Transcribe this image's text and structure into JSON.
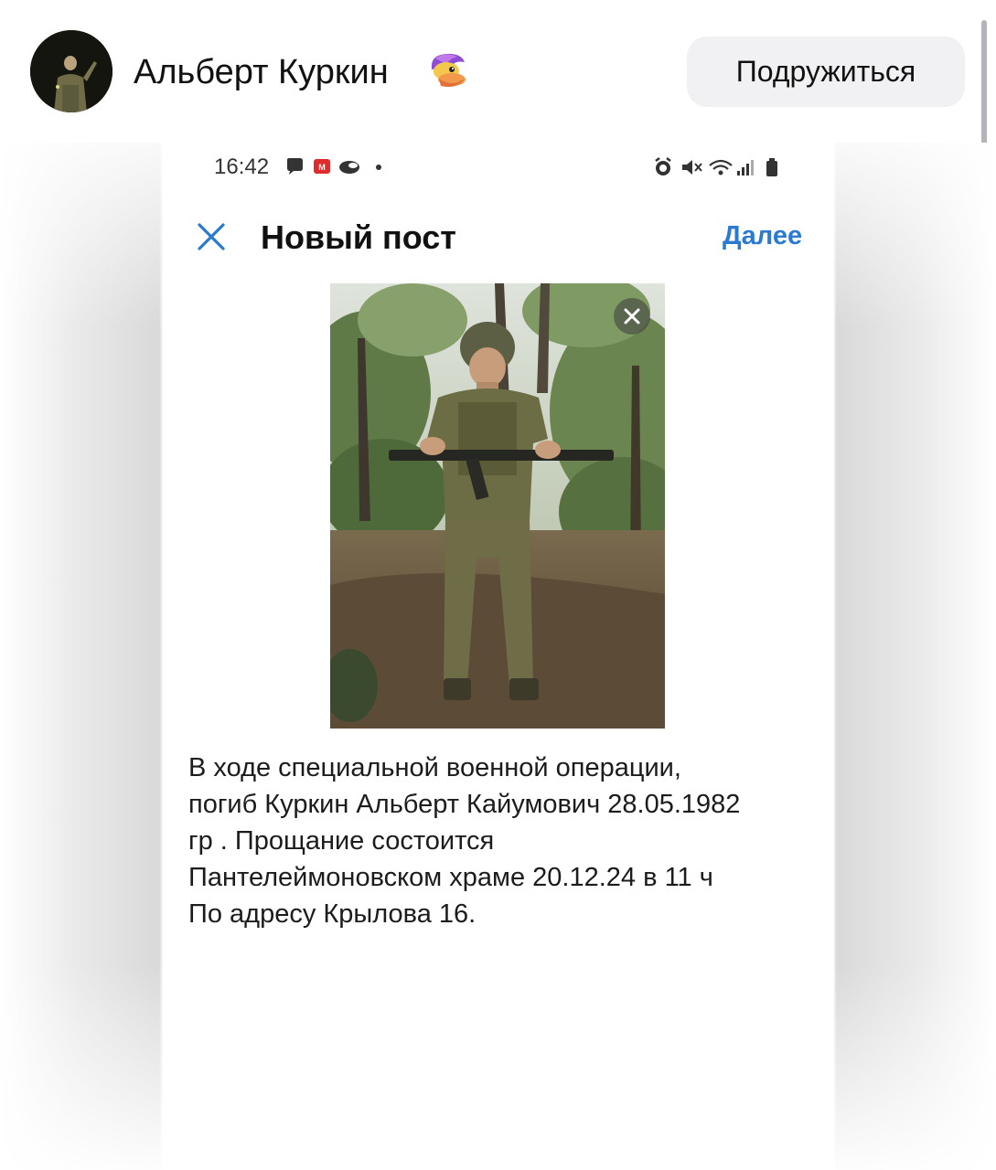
{
  "profile": {
    "name": "Альберт Куркин",
    "avatar_icon": "avatar-photo",
    "sticker_icon": "duck-sticker-icon",
    "friend_button_label": "Подружиться"
  },
  "post_screenshot": {
    "status_bar": {
      "time": "16:42",
      "left_icons": [
        "chat-bubble-icon",
        "magnit-app-icon",
        "cloud-icon",
        "dot-icon"
      ],
      "right_icons": [
        "alarm-icon",
        "mute-icon",
        "wifi-icon",
        "signal-icon",
        "battery-icon"
      ]
    },
    "header": {
      "close_icon": "close-icon",
      "title": "Новый пост",
      "next_label": "Далее"
    },
    "photo": {
      "description_icon": "soldier-photo",
      "remove_icon": "close-circle-icon"
    },
    "text_lines": [
      "В ходе специальной военной операции,",
      "погиб Куркин Альберт Кайумович 28.05.1982",
      "гр . Прощание состоится",
      "Пантелеймоновском храме 20.12.24 в 11 ч",
      "По адресу Крылова 16."
    ]
  },
  "colors": {
    "accent": "#2a7ad2",
    "button_bg": "#f1f1f3",
    "text": "#111111"
  }
}
